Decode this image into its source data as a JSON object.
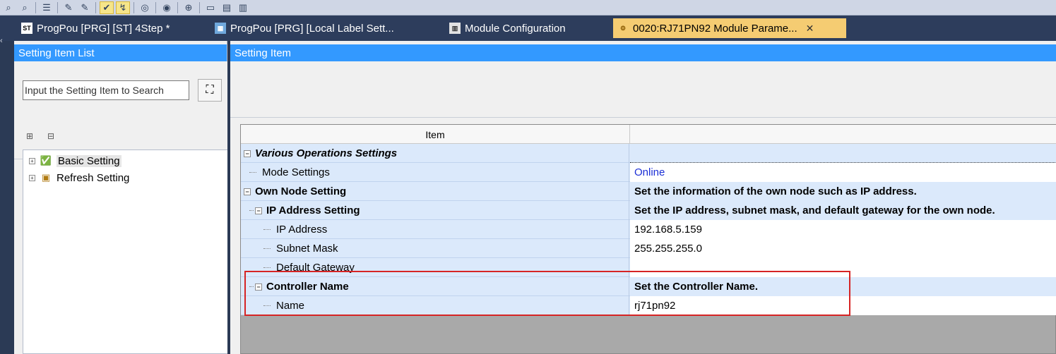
{
  "toolbar": {
    "icons": [
      "find-icon",
      "find-next-icon",
      "list-icon",
      "edit-icon",
      "edit-alt-icon",
      "check-icon",
      "convert-icon",
      "monitor-icon",
      "watch-icon",
      "zoom-icon",
      "print-preview-icon",
      "print-icon",
      "document-icon"
    ]
  },
  "tabs": [
    {
      "label": "ProgPou [PRG] [ST] 4Step *",
      "icon": "st-icon",
      "active": false
    },
    {
      "label": "ProgPou [PRG] [Local Label Sett...",
      "icon": "label-icon",
      "active": false
    },
    {
      "label": "Module Configuration",
      "icon": "module-config-icon",
      "active": false
    },
    {
      "label": "0020:RJ71PN92 Module Parame...",
      "icon": "module-parameter-icon",
      "active": true,
      "close": "✕"
    }
  ],
  "left_panel": {
    "header": "Setting Item List",
    "search_placeholder": "Input the Setting Item to Search",
    "tree": [
      {
        "label": "Basic Setting",
        "expander": "+",
        "selected": true
      },
      {
        "label": "Refresh Setting",
        "expander": "+",
        "selected": false
      }
    ]
  },
  "right_panel": {
    "header": "Setting Item",
    "grid": {
      "columns": [
        "Item",
        ""
      ],
      "rows": [
        {
          "item": "Various Operations Settings",
          "value": "",
          "level": 0,
          "type": "group-italic",
          "expander": "−"
        },
        {
          "item": "Mode Settings",
          "value": "Online",
          "level": 1,
          "type": "leaf"
        },
        {
          "item": "Own Node Setting",
          "value": "Set the information of the own node such as IP address.",
          "level": 0,
          "type": "group",
          "expander": "−"
        },
        {
          "item": "IP Address Setting",
          "value": "Set the IP address, subnet mask, and default gateway for the own node.",
          "level": 1,
          "type": "group",
          "expander": "−"
        },
        {
          "item": "IP Address",
          "value": "192.168.5.159",
          "level": 2,
          "type": "leaf"
        },
        {
          "item": "Subnet Mask",
          "value": "255.255.255.0",
          "level": 2,
          "type": "leaf"
        },
        {
          "item": "Default Gateway",
          "value": "",
          "level": 2,
          "type": "leaf"
        },
        {
          "item": "Controller Name",
          "value": "Set the Controller Name.",
          "level": 1,
          "type": "group",
          "expander": "−"
        },
        {
          "item": "Name",
          "value": "rj71pn92",
          "level": 2,
          "type": "leaf"
        }
      ]
    }
  },
  "colors": {
    "header_blue": "#3399ff",
    "active_tab": "#f5cc72",
    "row_blue": "#dbe9fb",
    "highlight_red": "#d62424",
    "link_blue": "#1b2fd6"
  }
}
